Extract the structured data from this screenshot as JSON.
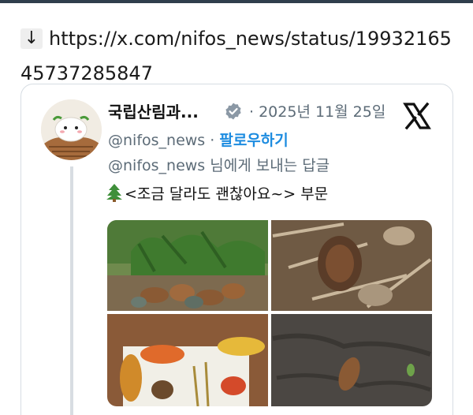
{
  "link": {
    "arrow": "↓",
    "url": "https://x.com/nifos_news/status/1993216545737285847"
  },
  "tweet": {
    "author_name": "국립산림과...",
    "separator": "·",
    "date": "2025년 11월 25일",
    "handle": "@nifos_news",
    "handle_separator": "·",
    "follow_label": "팔로우하기",
    "reply_handle": "@nifos_news",
    "reply_suffix": " 님에게 보내는 답글",
    "text": "<조금 달라도 괜찮아요~> 부문",
    "colors": {
      "follow": "#1d8ce0",
      "muted": "#5c6b77",
      "verified": "#8b98a5"
    },
    "icons": [
      "down-arrow-icon",
      "verified-badge-icon",
      "x-logo-icon",
      "christmas-tree-icon"
    ]
  }
}
